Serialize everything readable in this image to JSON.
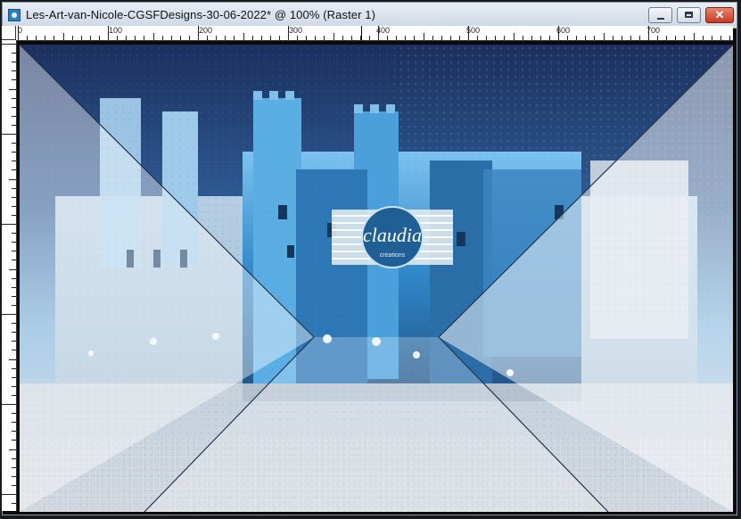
{
  "window": {
    "title": "Les-Art-van-Nicole-CGSFDesigns-30-06-2022* @ 100% (Raster 1)",
    "controls": {
      "minimize_icon": "minimize-icon",
      "maximize_icon": "maximize-icon",
      "close_icon": "close-icon",
      "close_glyph": "✕"
    },
    "app_icon": "image-document-icon"
  },
  "ruler": {
    "top_labels": [
      "0",
      "100",
      "200",
      "300",
      "400",
      "500",
      "600",
      "700"
    ]
  },
  "canvas": {
    "watermark": {
      "text": "claudia",
      "subtext": "creations"
    },
    "colors": {
      "night_sky": "#1f3b70",
      "castle_blue": "#3a8fd0",
      "fog": "#d9dde2",
      "frame_lines": "#23354a"
    }
  }
}
